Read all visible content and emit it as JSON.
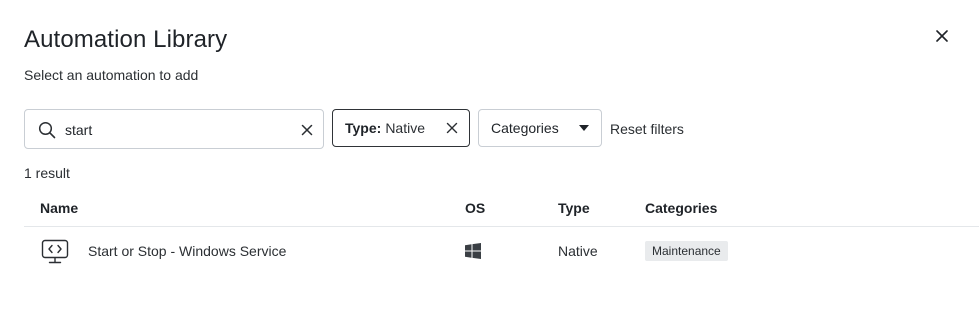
{
  "dialog": {
    "title": "Automation Library",
    "subtitle": "Select an automation to add",
    "close_icon": "close-icon"
  },
  "filters": {
    "search": {
      "value": "start",
      "placeholder": "",
      "icon": "search-icon",
      "clear_icon": "clear-icon"
    },
    "type_chip": {
      "key": "Type:",
      "value": "Native",
      "remove_icon": "close-icon"
    },
    "categories": {
      "label": "Categories",
      "icon": "caret-down-icon"
    },
    "reset_label": "Reset filters"
  },
  "results": {
    "count_label": "1 result",
    "columns": {
      "name": "Name",
      "os": "OS",
      "type": "Type",
      "categories": "Categories"
    },
    "rows": [
      {
        "icon": "script-monitor-icon",
        "name": "Start or Stop - Windows Service",
        "os_icon": "windows-icon",
        "type": "Native",
        "category": "Maintenance"
      }
    ]
  }
}
